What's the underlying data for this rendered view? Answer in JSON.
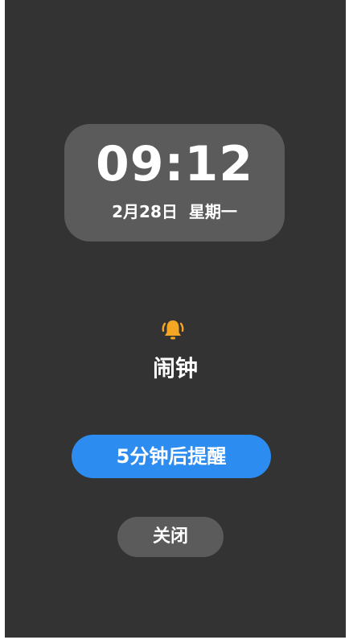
{
  "clock": {
    "time": "09:12",
    "date": "2月28日",
    "weekday": "星期一"
  },
  "alarm": {
    "icon": "bell-icon",
    "label": "闹钟",
    "accent_color": "#f5a623"
  },
  "actions": {
    "snooze_label": "5分钟后提醒",
    "snooze_color": "#2d8cf0",
    "close_label": "关闭"
  }
}
